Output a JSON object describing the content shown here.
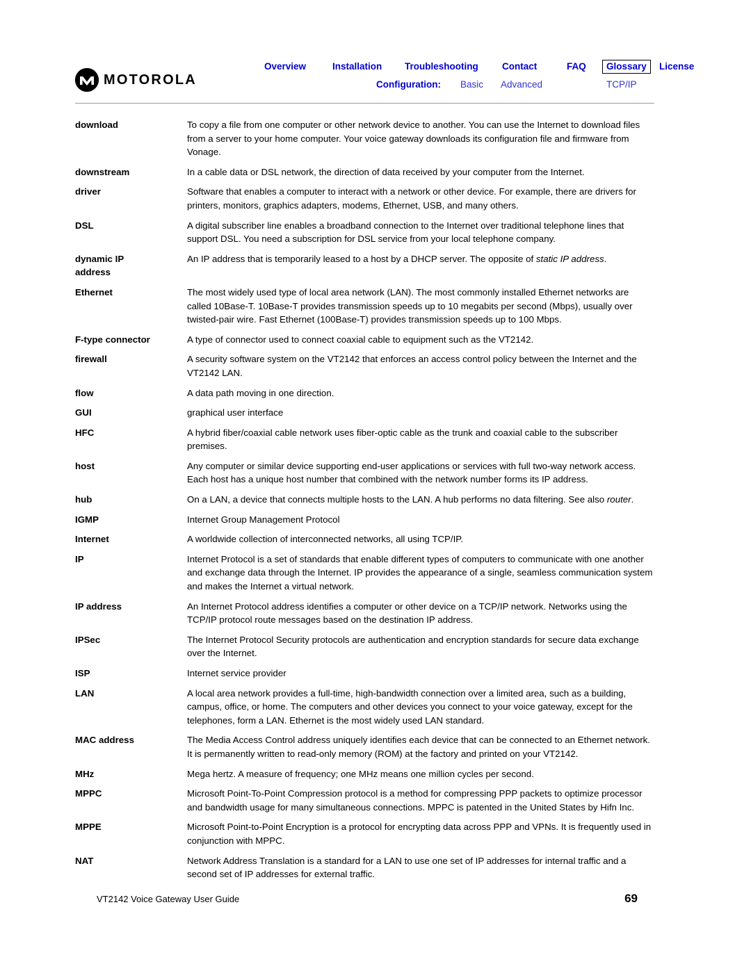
{
  "header": {
    "brand": "MOTOROLA",
    "nav_primary": [
      {
        "label": "Overview",
        "boxed": false
      },
      {
        "label": "Installation",
        "boxed": false
      },
      {
        "label": "Troubleshooting",
        "boxed": false
      },
      {
        "label": "Contact",
        "boxed": false
      },
      {
        "label": "FAQ",
        "boxed": false
      },
      {
        "label": "Glossary",
        "boxed": true
      },
      {
        "label": "License",
        "boxed": false
      }
    ],
    "config_label": "Configuration:",
    "config_items": [
      {
        "label": "Basic"
      },
      {
        "label": "Advanced"
      },
      {
        "label": "TCP/IP"
      }
    ],
    "accent_color": "#0000cc",
    "sub_color": "#3333cc"
  },
  "glossary": {
    "entries": [
      {
        "term": "download",
        "definition": "To copy a file from one computer or other network device to another. You can use the Internet to download files from a server to your home computer. Your voice gateway downloads its configuration file and firmware from Vonage."
      },
      {
        "term": "downstream",
        "definition": "In a cable data or DSL network, the direction of data received by your computer from the Internet."
      },
      {
        "term": "driver",
        "definition": "Software that enables a computer to interact with a network or other device. For example, there are drivers for printers, monitors, graphics adapters, modems, Ethernet, USB, and many others."
      },
      {
        "term": "DSL",
        "definition": "A digital subscriber line enables a broadband connection to the Internet over traditional telephone lines that support DSL. You need a subscription for DSL service from your local telephone company."
      },
      {
        "term": "dynamic IP address",
        "definition_html": "An IP address that is temporarily leased to a host by a DHCP server. The opposite of <i>static IP address</i>."
      },
      {
        "term": "Ethernet",
        "definition": "The most widely used type of local area network (LAN). The most commonly installed Ethernet networks are called 10Base-T. 10Base-T provides transmission speeds up to 10 megabits per second (Mbps), usually over twisted-pair wire. Fast Ethernet (100Base-T) provides transmission speeds up to 100 Mbps."
      },
      {
        "term": "F-type connector",
        "definition": "A type of connector used to connect coaxial cable to equipment such as the VT2142."
      },
      {
        "term": "firewall",
        "definition": "A security software system on the VT2142 that enforces an access control policy between the Internet and the VT2142 LAN."
      },
      {
        "term": "flow",
        "definition": "A data path moving in one direction."
      },
      {
        "term": "GUI",
        "definition": "graphical user interface"
      },
      {
        "term": "HFC",
        "definition": "A hybrid fiber/coaxial cable network uses fiber-optic cable as the trunk and coaxial cable to the subscriber premises."
      },
      {
        "term": "host",
        "definition": "Any computer or similar device supporting end-user applications or services with full two-way network access. Each host has a unique host number that combined with the network number forms its IP address."
      },
      {
        "term": "hub",
        "definition_html": "On a LAN, a device that connects multiple hosts to the LAN. A hub performs no data filtering. See also <i>router</i>."
      },
      {
        "term": "IGMP",
        "definition": "Internet Group Management Protocol"
      },
      {
        "term": "Internet",
        "definition": "A worldwide collection of interconnected networks, all using TCP/IP."
      },
      {
        "term": "IP",
        "definition": "Internet Protocol is a set of standards that enable different types of computers to communicate with one another and exchange data through the Internet. IP provides the appearance of a single, seamless communication system and makes the Internet a virtual network."
      },
      {
        "term": "IP address",
        "definition": "An Internet Protocol address identifies a computer or other device on a TCP/IP network. Networks using the TCP/IP protocol route messages based on the destination IP address."
      },
      {
        "term": "IPSec",
        "definition": "The Internet Protocol Security protocols are authentication and encryption standards for secure data exchange over the Internet."
      },
      {
        "term": "ISP",
        "definition": "Internet service provider"
      },
      {
        "term": "LAN",
        "definition": "A local area network provides a full-time, high-bandwidth connection over a limited area, such as a building, campus, office, or home. The computers and other devices you connect to your voice gateway, except for the telephones, form a LAN. Ethernet is the most widely used LAN standard."
      },
      {
        "term": "MAC address",
        "definition": "The Media Access Control address uniquely identifies each device that can be connected to an Ethernet network. It is permanently written to read-only memory (ROM) at the factory and printed on your VT2142."
      },
      {
        "term": "MHz",
        "definition": "Mega hertz. A measure of frequency; one MHz means one million cycles per second."
      },
      {
        "term": "MPPC",
        "definition": "Microsoft Point-To-Point Compression protocol is a method for compressing PPP packets to optimize processor and bandwidth usage for many simultaneous connections. MPPC is patented in the United States by Hifn Inc."
      },
      {
        "term": "MPPE",
        "definition": "Microsoft Point-to-Point Encryption is a protocol for encrypting data across PPP and VPNs. It is frequently used in conjunction with MPPC."
      },
      {
        "term": "NAT",
        "definition": "Network Address Translation is a standard for a LAN to use one set of IP addresses for internal traffic and a second set of IP addresses for external traffic."
      }
    ]
  },
  "footer": {
    "left": "VT2142 Voice Gateway User Guide",
    "page_number": "69"
  }
}
